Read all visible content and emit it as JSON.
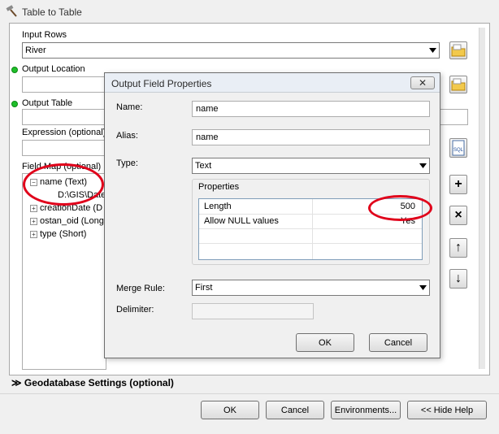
{
  "window": {
    "title": "Table to Table"
  },
  "form": {
    "input_rows_label": "Input Rows",
    "input_rows_value": "River",
    "output_location_label": "Output Location",
    "output_table_label": "Output Table",
    "expression_label": "Expression (optional)",
    "field_map_label": "Field Map (optional)",
    "field_map_items": [
      {
        "label": "name (Text)",
        "expanded": true
      },
      {
        "label": "D:\\GIS\\Date",
        "child": true
      },
      {
        "label": "creationDate (D",
        "expanded": false
      },
      {
        "label": "ostan_oid (Long",
        "expanded": false
      },
      {
        "label": "type (Short)",
        "expanded": false
      }
    ],
    "sql_label": "SQL",
    "geodatabase_settings_label": "Geodatabase Settings (optional)"
  },
  "side_buttons": {
    "add": "+",
    "remove": "×",
    "up": "↑",
    "down": "↓"
  },
  "footer": {
    "ok_label": "OK",
    "cancel_label": "Cancel",
    "environments_label": "Environments...",
    "hide_help_label": "<< Hide Help"
  },
  "dialog": {
    "title": "Output Field Properties",
    "close_label": "✕",
    "name_label": "Name:",
    "name_value": "name",
    "alias_label": "Alias:",
    "alias_value": "name",
    "type_label": "Type:",
    "type_value": "Text",
    "properties_label": "Properties",
    "properties": [
      {
        "key": "Length",
        "value": "500"
      },
      {
        "key": "Allow NULL values",
        "value": "Yes"
      }
    ],
    "merge_rule_label": "Merge Rule:",
    "merge_rule_value": "First",
    "delimiter_label": "Delimiter:",
    "ok_label": "OK",
    "cancel_label": "Cancel"
  },
  "colors": {
    "required_dot": "#1fbf2a",
    "annotation": "#e0001a",
    "grid_border": "#7f9db9"
  },
  "icons": [
    "hammer-icon",
    "folder-icon",
    "sql-icon",
    "plus-icon",
    "close-icon",
    "arrow-up-icon",
    "arrow-down-icon",
    "chevron-down-icon"
  ]
}
